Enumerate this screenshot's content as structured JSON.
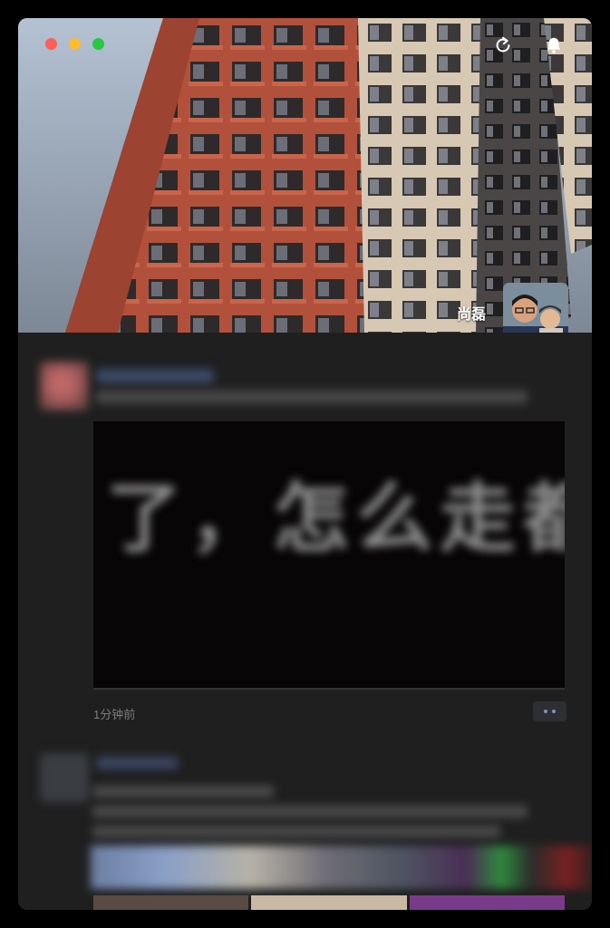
{
  "cover": {
    "username": "尚磊",
    "icons": [
      "refresh-icon",
      "bell-icon"
    ]
  },
  "window": {
    "traffic_lights": [
      "#fe5f57",
      "#febc2e",
      "#28c840"
    ]
  },
  "feed": {
    "post1": {
      "video_caption": "了，怎么走都",
      "time": "1分钟前"
    }
  }
}
